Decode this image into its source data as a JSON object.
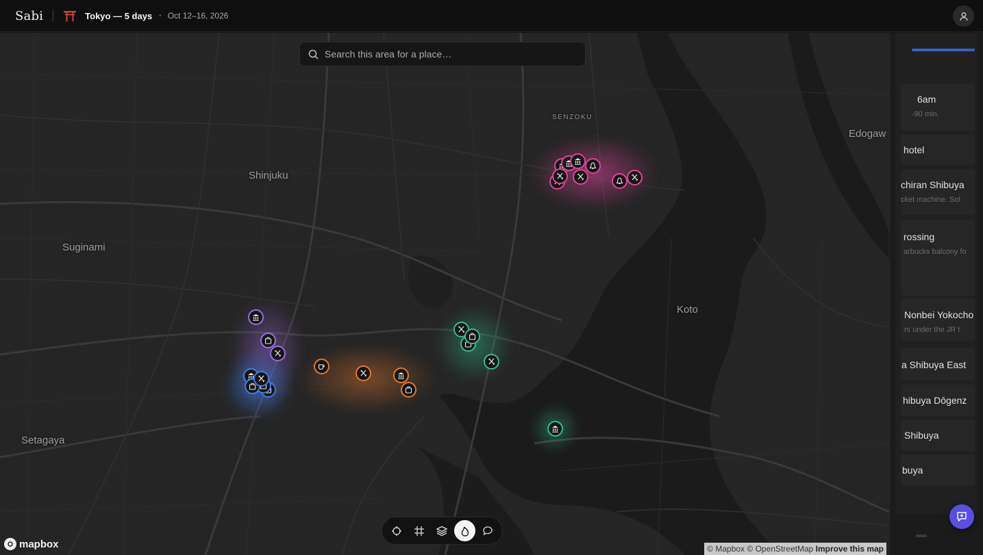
{
  "app": {
    "name": "Sabi"
  },
  "trip": {
    "title": "Tokyo — 5 days",
    "dates": "Oct 12–16, 2026"
  },
  "header": {
    "avatar_icon": "user-icon"
  },
  "search": {
    "placeholder": "Search this area for a place…"
  },
  "map": {
    "places": [
      "Shinjuku",
      "Suginami",
      "Setagaya",
      "Koto",
      "SENZOKU",
      "Edogaw"
    ],
    "day_colors": {
      "pink": "#e0449a",
      "purple": "#9b6de0",
      "blue": "#3e7ee8",
      "orange": "#e5782a",
      "green": "#2fbf8a"
    },
    "branding": "mapbox",
    "attribution": {
      "text": "© Mapbox © OpenStreetMap",
      "link": "Improve this map"
    }
  },
  "toolbar": {
    "tools": [
      {
        "icon": "crosshair-icon",
        "active": false
      },
      {
        "icon": "hashtag-icon",
        "active": false
      },
      {
        "icon": "layers-icon",
        "active": false
      },
      {
        "icon": "flame-icon",
        "active": true
      },
      {
        "icon": "chat-bubble-icon",
        "active": false
      }
    ]
  },
  "itinerary": {
    "items": [
      {
        "title": "6am",
        "subtitle": "-90 min."
      },
      {
        "title": "hotel",
        "subtitle": ""
      },
      {
        "title": "chiran Shibuya",
        "subtitle": "cket machine. Sol"
      },
      {
        "title": "rossing",
        "subtitle": "arbucks balcony fo"
      },
      {
        "title": "Nonbei Yokocho",
        "subtitle": "rs under the JR t"
      },
      {
        "title": "a Shibuya East",
        "subtitle": ""
      },
      {
        "title": "hibuya Dōgenz",
        "subtitle": ""
      },
      {
        "title": "Shibuya",
        "subtitle": ""
      },
      {
        "title": "buya",
        "subtitle": ""
      }
    ]
  },
  "fab": {
    "icon": "chat-add-icon"
  }
}
